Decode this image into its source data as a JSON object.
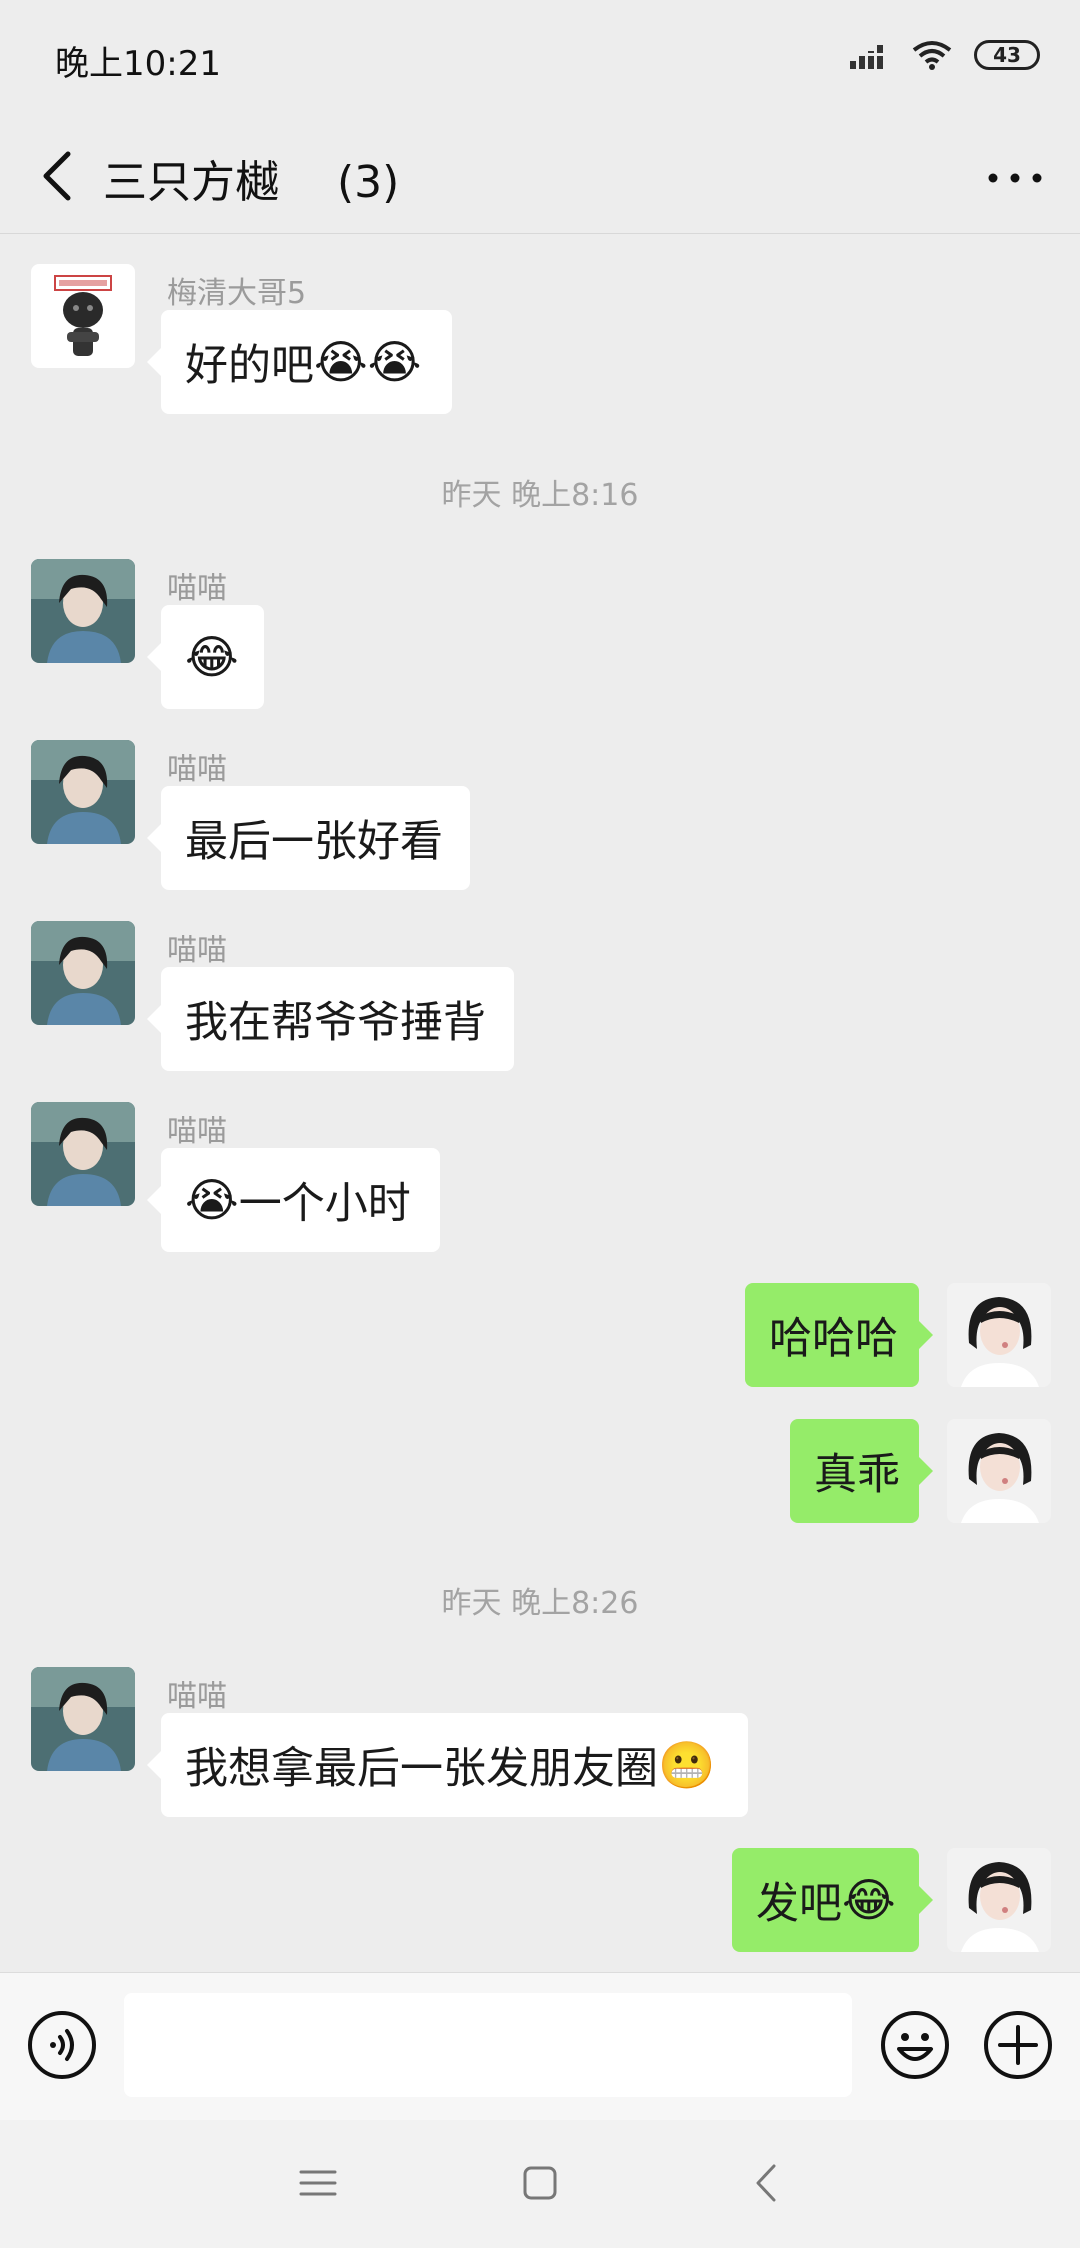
{
  "status_bar": {
    "time": "晚上10:21",
    "battery": "43",
    "icons": [
      "signal-icon",
      "wifi-icon",
      "battery-icon"
    ]
  },
  "header": {
    "title": "三只方樾　 (3)",
    "back_icon": "chevron-left-icon",
    "more_icon": "more-dots-icon"
  },
  "messages": [
    {
      "side": "left",
      "sender": "梅清大哥5",
      "text": "好的吧",
      "emojis": [
        "😭",
        "😭"
      ]
    },
    {
      "type": "timestamp",
      "text": "昨天 晚上8:16"
    },
    {
      "side": "left",
      "sender": "喵喵",
      "text": "",
      "emojis": [
        "😂"
      ]
    },
    {
      "side": "left",
      "sender": "喵喵",
      "text": "最后一张好看"
    },
    {
      "side": "left",
      "sender": "喵喵",
      "text": "我在帮爷爷捶背"
    },
    {
      "side": "left",
      "sender": "喵喵",
      "text": "一个小时",
      "leading_emoji": "😭"
    },
    {
      "side": "right",
      "text": "哈哈哈"
    },
    {
      "side": "right",
      "text": "真乖"
    },
    {
      "type": "timestamp",
      "text": "昨天 晚上8:26"
    },
    {
      "side": "left",
      "sender": "喵喵",
      "text": "我想拿最后一张发朋友圈",
      "emojis": [
        "😬"
      ]
    },
    {
      "side": "right",
      "text": "发吧",
      "emojis": [
        "😂"
      ]
    }
  ],
  "input_bar": {
    "placeholder": "",
    "voice_icon": "voice-icon",
    "emoji_icon": "smiley-icon",
    "plus_icon": "plus-icon"
  },
  "nav_bar": {
    "icons": [
      "menu-icon",
      "home-square-icon",
      "back-icon"
    ]
  },
  "colors": {
    "background": "#ededed",
    "own_bubble": "#95ec69",
    "other_bubble": "#ffffff",
    "timestamp": "#a3a3a3"
  }
}
